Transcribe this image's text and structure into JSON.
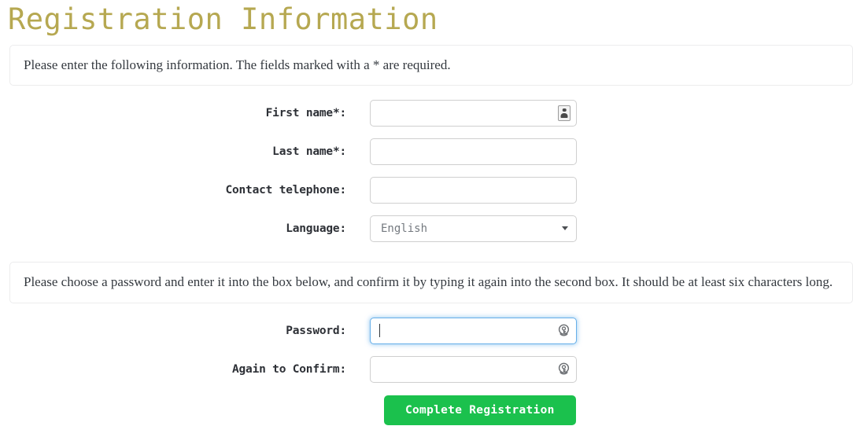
{
  "page": {
    "title": "Registration Information"
  },
  "intro_panel": {
    "text": "Please enter the following information. The fields marked with a * are required."
  },
  "password_panel": {
    "text": "Please choose a password and enter it into the box below, and confirm it by typing it again into the second box. It should be at least six characters long."
  },
  "fields": {
    "first_name": {
      "label": "First name*:",
      "value": "",
      "placeholder": "",
      "icon": "contact-card-icon"
    },
    "last_name": {
      "label": "Last name*:",
      "value": "",
      "placeholder": ""
    },
    "telephone": {
      "label": "Contact telephone:",
      "value": "",
      "placeholder": ""
    },
    "language": {
      "label": "Language:",
      "selected": "English",
      "options": [
        "English"
      ],
      "icon": "chevron-down-icon"
    },
    "password": {
      "label": "Password:",
      "value": "",
      "placeholder": "",
      "focused": true,
      "icon": "key-icon"
    },
    "confirm_password": {
      "label": "Again to Confirm:",
      "value": "",
      "placeholder": "",
      "focused": false,
      "icon": "key-icon"
    }
  },
  "actions": {
    "submit_label": "Complete Registration"
  },
  "colors": {
    "title": "#b6a851",
    "submit_background": "#1bc14d",
    "submit_text": "#ffffff",
    "focus_ring": "#66afe9",
    "input_border": "#cfcfcf",
    "panel_border": "#ececed",
    "page_background": "#ffffff"
  }
}
